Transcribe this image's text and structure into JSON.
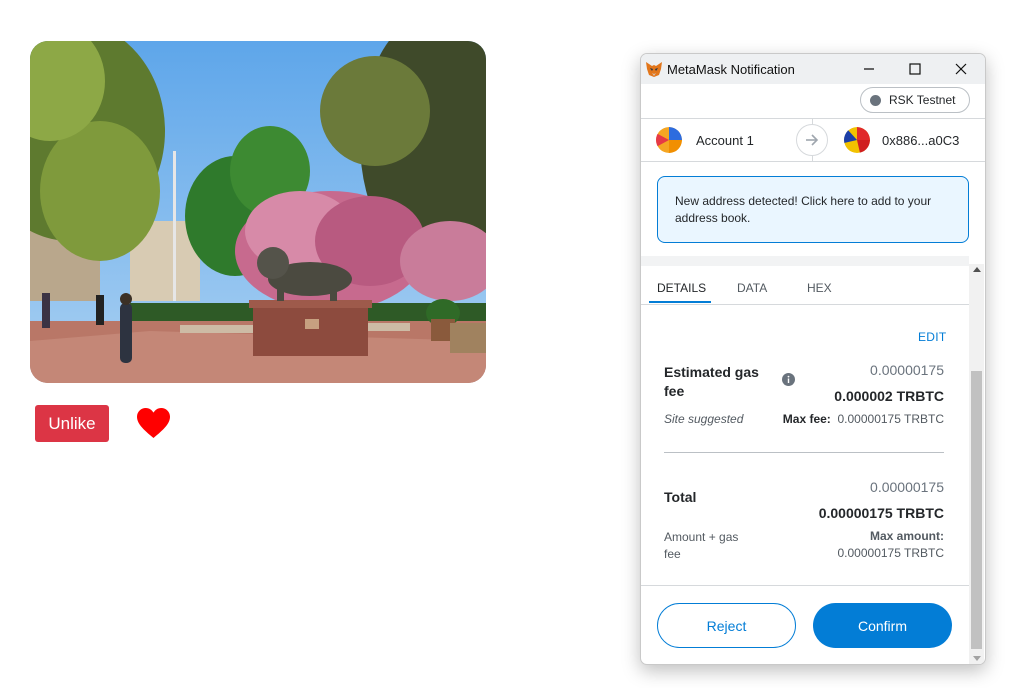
{
  "page": {
    "photo_alt": "Campus courtyard with lion statue and blossoming trees",
    "unlike_label": "Unlike"
  },
  "window": {
    "title": "MetaMask Notification"
  },
  "network": {
    "name": "RSK Testnet"
  },
  "accounts": {
    "from_name": "Account 1",
    "to_address": "0x886...a0C3"
  },
  "notice": {
    "text": "New address detected! Click here to add to your address book."
  },
  "tabs": [
    "DETAILS",
    "DATA",
    "HEX"
  ],
  "details": {
    "edit_label": "EDIT",
    "gas_label": "Estimated gas fee",
    "gas_fiat": "0.00000175",
    "gas_native": "0.000002 TRBTC",
    "site_suggested": "Site suggested",
    "max_fee_label": "Max fee:",
    "max_fee_value": "0.00000175 TRBTC",
    "total_label": "Total",
    "total_fiat": "0.00000175",
    "total_native": "0.00000175 TRBTC",
    "amount_gas_label": "Amount + gas fee",
    "max_amount_label": "Max amount:",
    "max_amount_value": "0.00000175 TRBTC"
  },
  "footer": {
    "reject_label": "Reject",
    "confirm_label": "Confirm"
  },
  "colors": {
    "accent": "#037dd6",
    "unlike_bg": "#dc3545",
    "heart": "#ff0000",
    "notice_bg": "#eaf6ff"
  }
}
